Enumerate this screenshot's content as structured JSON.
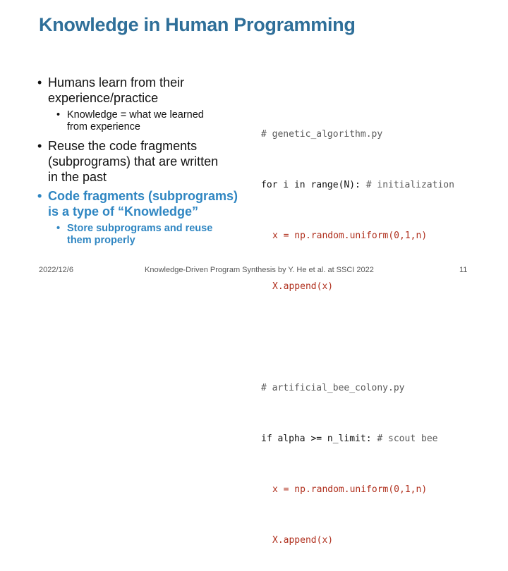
{
  "slide": {
    "title": "Knowledge in Human Programming",
    "bullets": {
      "b1_line1": "Humans learn from their",
      "b1_line2": "experience/practice",
      "b1_sub_line1": "Knowledge = what we learned",
      "b1_sub_line2": "from experience",
      "b2_line1": "Reuse the code fragments",
      "b2_line2": "(subprograms) that are written",
      "b2_line3": "in the past",
      "b3_line1": "Code fragments (subprograms)",
      "b3_line2": "is a type of “Knowledge”",
      "b3_sub_line1": "Store subprograms and reuse",
      "b3_sub_line2": "them properly"
    },
    "code": {
      "c1": "# genetic_algorithm.py",
      "c2_stmt": "for i in range(N): ",
      "c2_comment": "# initialization",
      "c3": "x = np.random.uniform(0,1,n)",
      "c4": "X.append(x)",
      "c5": "# artificial_bee_colony.py",
      "c6_stmt": "if alpha >= n_limit: ",
      "c6_comment": "# scout bee",
      "c7": "x = np.random.uniform(0,1,n)",
      "c8": "X.append(x)"
    },
    "footer": {
      "date": "2022/12/6",
      "center": "Knowledge-Driven Program Synthesis by Y. He et al. at SSCI 2022",
      "page": "11"
    }
  }
}
